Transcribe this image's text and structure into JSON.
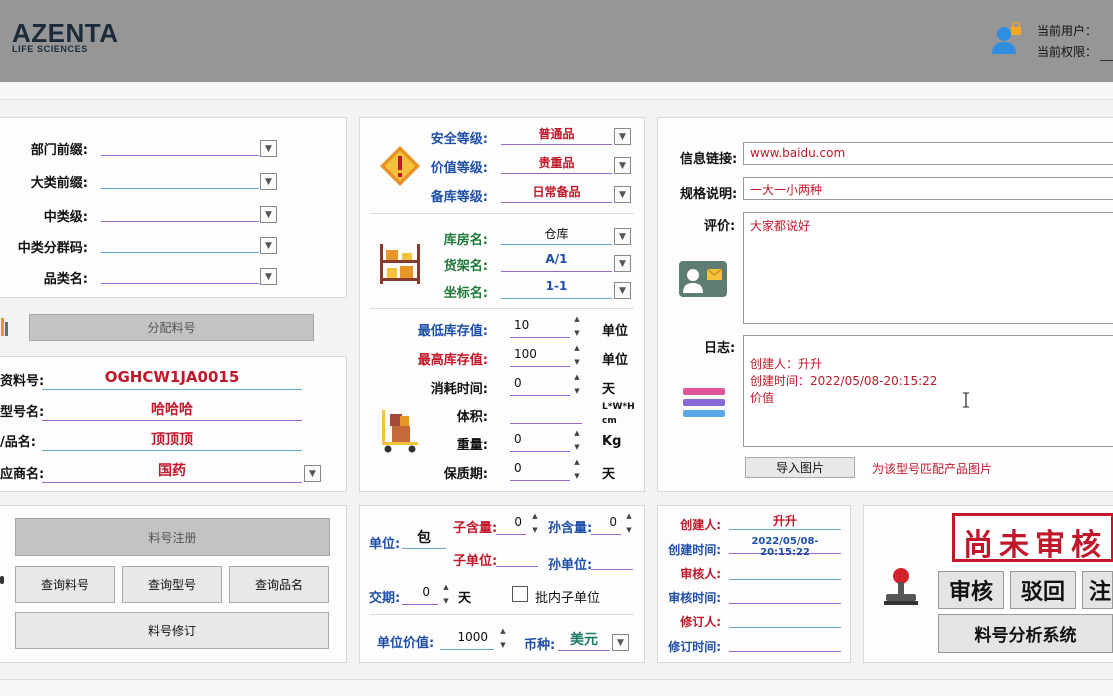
{
  "header": {
    "logo_main": "AZENTA",
    "logo_sub": "LIFE SCIENCES",
    "current_user_label": "当前用户：",
    "current_perm_label": "当前权限："
  },
  "category_panel": {
    "dept_prefix": "部门前缀:",
    "major_prefix": "大类前缀:",
    "mid_level": "中类级:",
    "mid_group_code": "中类分群码:",
    "category_name": "品类名:",
    "assign_button": "分配料号"
  },
  "material_panel": {
    "material_no_label": "资料号:",
    "material_no_value": "OGHCW1JA0015",
    "model_label": "型号名:",
    "model_value": "哈哈哈",
    "product_label": "/品名:",
    "product_value": "顶顶顶",
    "supplier_label": "应商名:",
    "supplier_value": "国药"
  },
  "actions": {
    "register": "料号注册",
    "query_material": "查询料号",
    "query_model": "查询型号",
    "query_product": "查询品名",
    "revise": "料号修订"
  },
  "grade_panel": {
    "safety_label": "安全等级:",
    "safety_value": "普通品",
    "value_label": "价值等级:",
    "value_value": "贵重品",
    "stock_label": "备库等级:",
    "stock_value": "日常备品"
  },
  "location_panel": {
    "warehouse_label": "库房名:",
    "warehouse_value": "仓库",
    "shelf_label": "货架名:",
    "shelf_value": "A/1",
    "coord_label": "坐标名:",
    "coord_value": "1-1"
  },
  "stock_panel": {
    "min_label": "最低库存值:",
    "min_value": "10",
    "min_unit": "单位",
    "max_label": "最高库存值:",
    "max_value": "100",
    "max_unit": "单位",
    "consume_label": "消耗时间:",
    "consume_value": "0",
    "consume_unit": "天",
    "volume_label": "体积:",
    "volume_unit_1": "L*W*H",
    "volume_unit_2": "cm",
    "weight_label": "重量:",
    "weight_value": "0",
    "weight_unit": "Kg",
    "shelf_life_label": "保质期:",
    "shelf_life_value": "0",
    "shelf_life_unit": "天"
  },
  "unit_panel": {
    "unit_label": "单位:",
    "unit_value": "包",
    "sub_qty_label": "子含量:",
    "sub_qty_value": "0",
    "grand_qty_label": "孙含量:",
    "grand_qty_value": "0",
    "sub_unit_label": "子单位:",
    "grand_unit_label": "孙单位:",
    "lead_label": "交期:",
    "lead_value": "0",
    "lead_unit": "天",
    "batch_label": "批内子单位",
    "price_label": "单位价值:",
    "price_value": "1000",
    "currency_label": "币种:",
    "currency_value": "美元"
  },
  "info_panel": {
    "link_label": "信息链接:",
    "link_value": "www.baidu.com",
    "spec_label": "规格说明:",
    "spec_value": "一大一小两种",
    "review_label": "评价:",
    "review_value": "大家都说好",
    "log_label": "日志:",
    "log_lines": [
      "创建人：升升",
      "创建时间：2022/05/08-20:15:22",
      "价值"
    ],
    "import_button": "导入图片",
    "import_hint": "为该型号匹配产品图片"
  },
  "audit_panel": {
    "creator_label": "创建人:",
    "creator_value": "升升",
    "create_time_label": "创建时间:",
    "create_time_value": "2022/05/08-20:15:22",
    "auditor_label": "审核人:",
    "audit_time_label": "审核时间:",
    "reviser_label": "修订人:",
    "revise_time_label": "修订时间:"
  },
  "review_panel": {
    "stamp_text": "尚未审核",
    "approve_button": "审核",
    "reject_button": "驳回",
    "third_button": "注",
    "analysis_button": "料号分析系统"
  },
  "colors": {
    "header": "#969696",
    "accent_red": "#c0182a",
    "accent_blue": "#1f4fa8",
    "field_line": "#9a66c9"
  }
}
